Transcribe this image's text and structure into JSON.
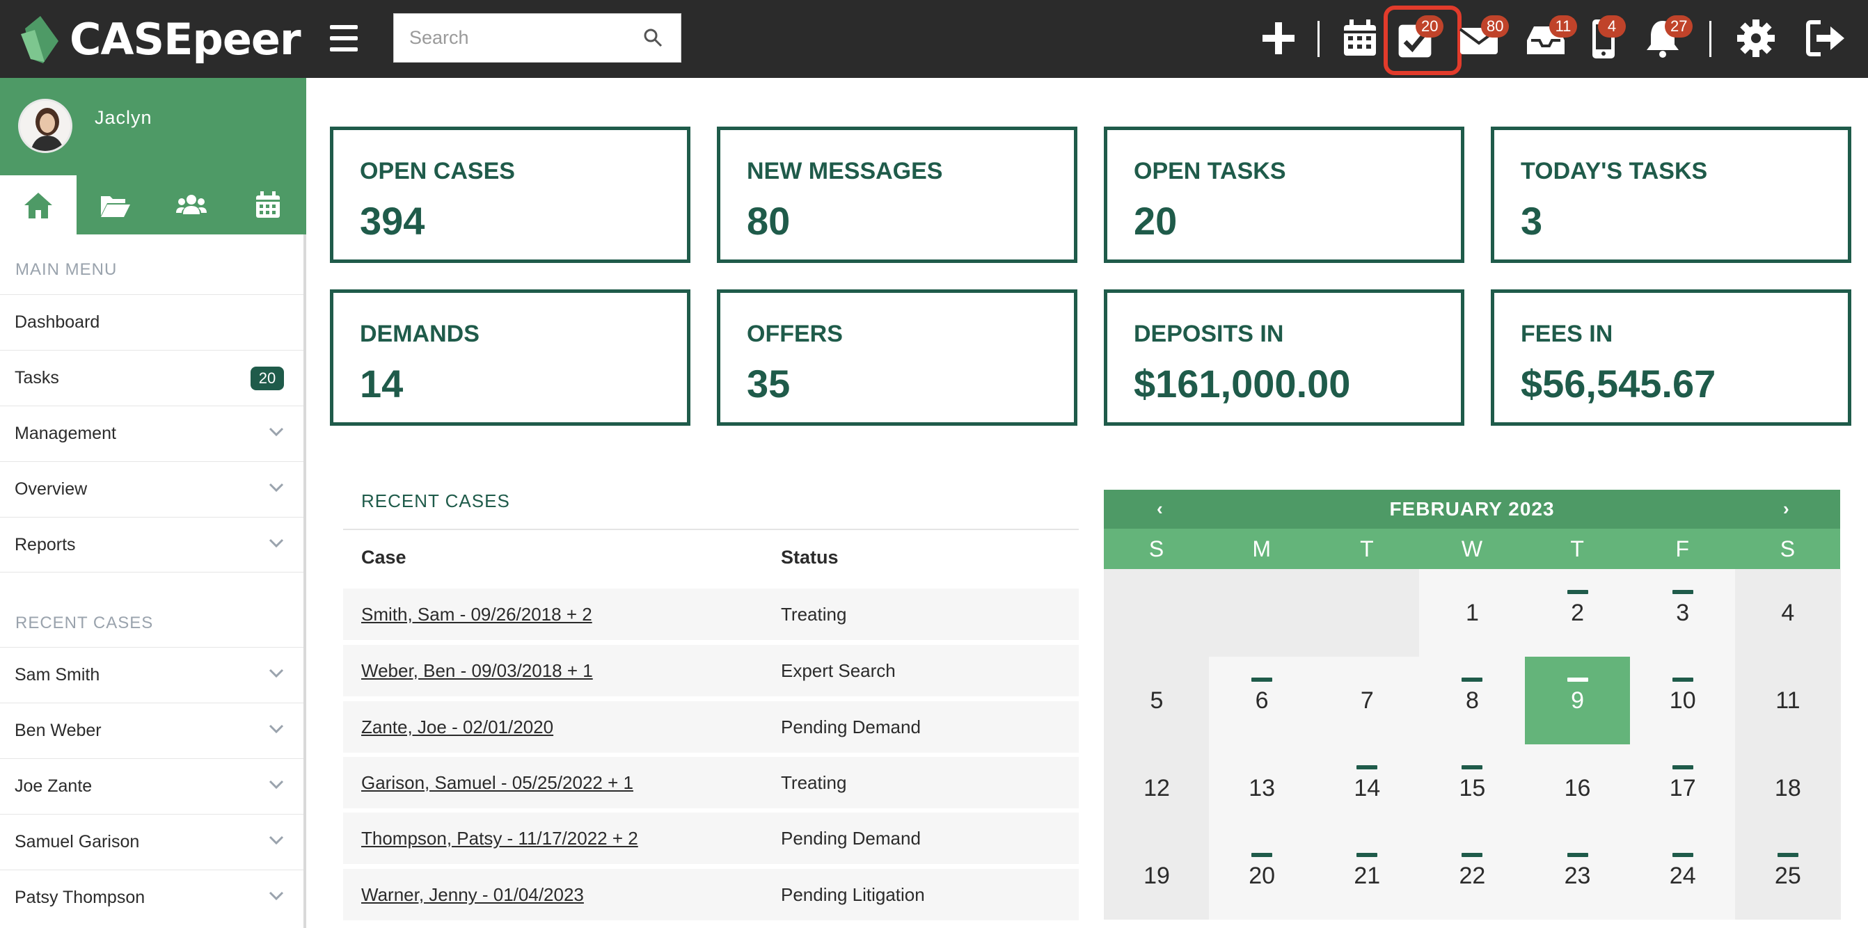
{
  "brand": {
    "name": "CASEpeer"
  },
  "search": {
    "placeholder": "Search"
  },
  "topbar": {
    "badges": {
      "tasks": "20",
      "messages": "80",
      "inbox": "11",
      "mobile": "4",
      "notifications": "27"
    }
  },
  "user": {
    "name": "Jaclyn"
  },
  "sidebar": {
    "main_menu_label": "MAIN MENU",
    "items": [
      {
        "label": "Dashboard"
      },
      {
        "label": "Tasks",
        "count": "20"
      },
      {
        "label": "Management"
      },
      {
        "label": "Overview"
      },
      {
        "label": "Reports"
      }
    ],
    "recent_label": "RECENT CASES",
    "recent": [
      {
        "label": "Sam Smith"
      },
      {
        "label": "Ben Weber"
      },
      {
        "label": "Joe Zante"
      },
      {
        "label": "Samuel Garison"
      },
      {
        "label": "Patsy Thompson"
      }
    ]
  },
  "stats": [
    {
      "title": "OPEN CASES",
      "value": "394"
    },
    {
      "title": "NEW MESSAGES",
      "value": "80"
    },
    {
      "title": "OPEN TASKS",
      "value": "20"
    },
    {
      "title": "TODAY'S TASKS",
      "value": "3"
    },
    {
      "title": "DEMANDS",
      "value": "14"
    },
    {
      "title": "OFFERS",
      "value": "35"
    },
    {
      "title": "DEPOSITS IN",
      "value": "$161,000.00"
    },
    {
      "title": "FEES IN",
      "value": "$56,545.67"
    }
  ],
  "recent_cases": {
    "title": "RECENT CASES",
    "headers": {
      "case": "Case",
      "status": "Status"
    },
    "rows": [
      {
        "case": "Smith, Sam - 09/26/2018 + 2",
        "status": "Treating"
      },
      {
        "case": "Weber, Ben - 09/03/2018 + 1",
        "status": "Expert Search"
      },
      {
        "case": "Zante, Joe - 02/01/2020",
        "status": "Pending Demand"
      },
      {
        "case": "Garison, Samuel - 05/25/2022 + 1",
        "status": "Treating"
      },
      {
        "case": "Thompson, Patsy - 11/17/2022 + 2",
        "status": "Pending Demand"
      },
      {
        "case": "Warner, Jenny - 01/04/2023",
        "status": "Pending Litigation"
      }
    ]
  },
  "calendar": {
    "month": "FEBRUARY 2023",
    "prev": "‹",
    "next": "›",
    "weekdays": [
      "S",
      "M",
      "T",
      "W",
      "T",
      "F",
      "S"
    ],
    "first_weekday": 3,
    "today": 9,
    "days": [
      {
        "day": "1",
        "mark": false
      },
      {
        "day": "2",
        "mark": true
      },
      {
        "day": "3",
        "mark": true
      },
      {
        "day": "4",
        "mark": false
      },
      {
        "day": "5",
        "mark": false
      },
      {
        "day": "6",
        "mark": true
      },
      {
        "day": "7",
        "mark": false
      },
      {
        "day": "8",
        "mark": true
      },
      {
        "day": "9",
        "mark": true
      },
      {
        "day": "10",
        "mark": true
      },
      {
        "day": "11",
        "mark": false
      },
      {
        "day": "12",
        "mark": false
      },
      {
        "day": "13",
        "mark": false
      },
      {
        "day": "14",
        "mark": true
      },
      {
        "day": "15",
        "mark": true
      },
      {
        "day": "16",
        "mark": false
      },
      {
        "day": "17",
        "mark": true
      },
      {
        "day": "18",
        "mark": false
      },
      {
        "day": "19",
        "mark": false
      },
      {
        "day": "20",
        "mark": true
      },
      {
        "day": "21",
        "mark": true
      },
      {
        "day": "22",
        "mark": true
      },
      {
        "day": "23",
        "mark": true
      },
      {
        "day": "24",
        "mark": true
      },
      {
        "day": "25",
        "mark": true
      }
    ]
  },
  "colors": {
    "topbar": "#2b2b2b",
    "brand_green": "#4e9a66",
    "dark_green": "#1f5b4a",
    "badge_red": "#c0432a",
    "highlight": "#e23b2b"
  }
}
